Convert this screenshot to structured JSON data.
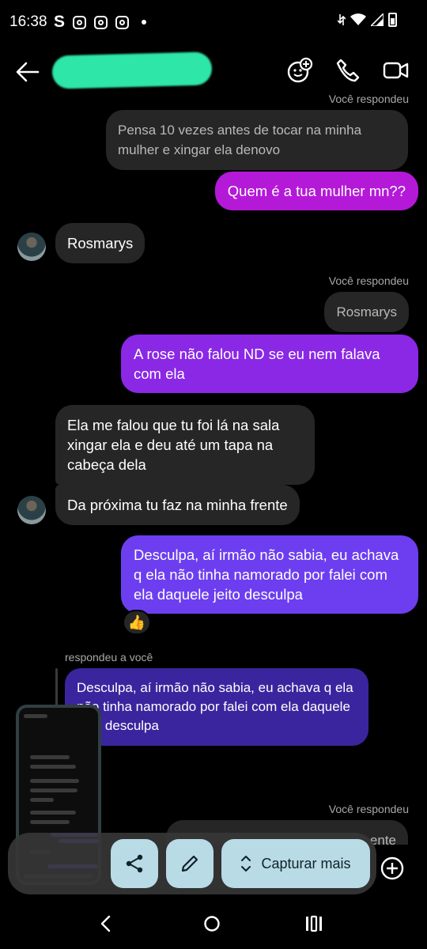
{
  "status_bar": {
    "time": "16:38",
    "app_letter": "S"
  },
  "header": {
    "contact_name_redacted": true
  },
  "messages": {
    "meta_top": "Você respondeu",
    "quoted_1": "Pensa 10 vezes antes de tocar na minha mulher e xingar ela denovo",
    "out_1": "Quem é a tua mulher mn??",
    "in_1": "Rosmarys",
    "meta_2": "Você respondeu",
    "quoted_2": "Rosmarys",
    "out_2": "A rose não falou ND se eu nem falava com ela",
    "in_2": "Ela me falou que tu foi lá na sala xingar ela e deu até um tapa na cabeça dela",
    "in_3": "Da próxima tu faz na minha frente",
    "out_3": "Desculpa, aí irmão não sabia, eu achava q ela não tinha namorado por falei com ela daquele jeito desculpa",
    "reaction_3": "👍",
    "meta_4": "respondeu a você",
    "quoted_4": "Desculpa, aí irmão não sabia, eu achava q ela não tinha namorado por falei com ela daquele jeito desculpa",
    "meta_5": "Você respondeu",
    "quoted_5_tail": "ente"
  },
  "toolbar": {
    "capture_more": "Capturar mais"
  },
  "colors": {
    "accent_magenta": "#b419d8",
    "accent_purple": "#7a36f2",
    "toolbar_button": "#b8dbe6"
  }
}
